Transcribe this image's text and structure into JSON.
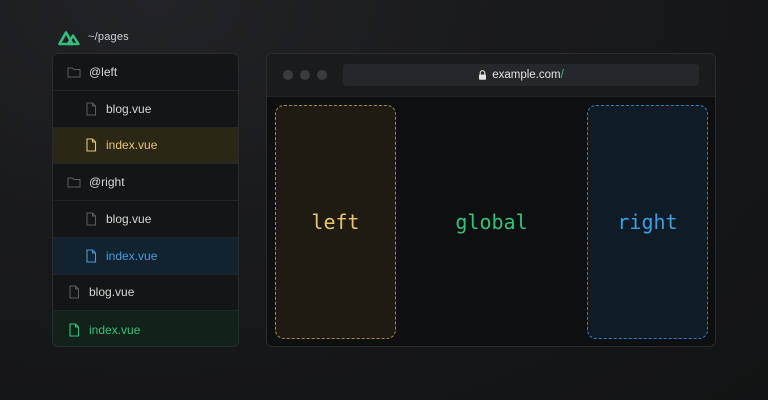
{
  "header": {
    "logo_icon": "nuxt-logo-icon",
    "path": "~/pages"
  },
  "tree": {
    "items": [
      {
        "label": "@left",
        "icon": "folder-icon",
        "level": 0,
        "highlight": null
      },
      {
        "label": "blog.vue",
        "icon": "file-icon",
        "level": 1,
        "highlight": null
      },
      {
        "label": "index.vue",
        "icon": "file-icon",
        "level": 1,
        "highlight": "yellow"
      },
      {
        "label": "@right",
        "icon": "folder-icon",
        "level": 0,
        "highlight": null
      },
      {
        "label": "blog.vue",
        "icon": "file-icon",
        "level": 1,
        "highlight": null
      },
      {
        "label": "index.vue",
        "icon": "file-icon",
        "level": 1,
        "highlight": "blue"
      },
      {
        "label": "blog.vue",
        "icon": "file-icon",
        "level": 0,
        "highlight": null
      },
      {
        "label": "index.vue",
        "icon": "file-icon",
        "level": 0,
        "highlight": "green"
      }
    ]
  },
  "browser": {
    "url_host": "example.com",
    "url_path": "/",
    "lock_icon": "lock-icon",
    "slots": {
      "left": "left",
      "global": "global",
      "right": "right"
    }
  },
  "colors": {
    "yellow": "#e9c46a",
    "blue": "#3b9ee4",
    "green": "#34c07a"
  }
}
